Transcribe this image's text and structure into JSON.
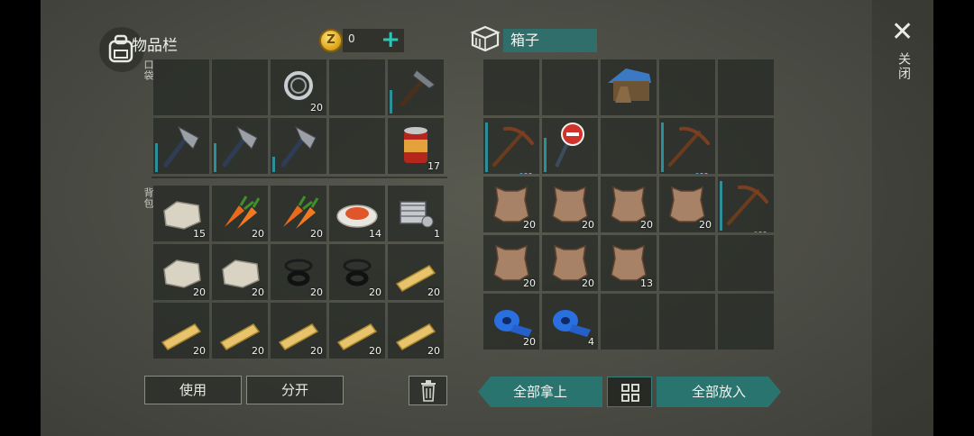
{
  "inventory": {
    "title": "物品栏",
    "coins": "0",
    "coin_symbol": "Z",
    "plus": "+",
    "pocket_label": "口袋",
    "backpack_label": "背包",
    "pocket_slots": [
      {
        "icon": "",
        "count": ""
      },
      {
        "icon": "",
        "count": ""
      },
      {
        "icon": "bearing-icon",
        "count": "20"
      },
      {
        "icon": "",
        "count": ""
      },
      {
        "icon": "hammer-icon",
        "count": "",
        "durability": 0.45
      },
      {
        "icon": "hatchet-icon",
        "count": "",
        "durability": 0.55
      },
      {
        "icon": "hatchet-icon",
        "count": "",
        "durability": 0.55
      },
      {
        "icon": "hatchet-icon",
        "count": "",
        "durability": 0.3
      },
      {
        "icon": "",
        "count": ""
      },
      {
        "icon": "canned-food-icon",
        "count": "17"
      }
    ],
    "backpack_slots": [
      {
        "icon": "stone-icon",
        "count": "15"
      },
      {
        "icon": "carrot-icon",
        "count": "20"
      },
      {
        "icon": "carrot-icon",
        "count": "20"
      },
      {
        "icon": "meal-plate-icon",
        "count": "14"
      },
      {
        "icon": "engine-icon",
        "count": "1"
      },
      {
        "icon": "stone-icon",
        "count": "20"
      },
      {
        "icon": "stone-icon",
        "count": "20"
      },
      {
        "icon": "rubber-ring-icon",
        "count": "20"
      },
      {
        "icon": "rubber-ring-icon",
        "count": "20"
      },
      {
        "icon": "plank-icon",
        "count": "20"
      },
      {
        "icon": "plank-icon",
        "count": "20"
      },
      {
        "icon": "plank-icon",
        "count": "20"
      },
      {
        "icon": "plank-icon",
        "count": "20"
      },
      {
        "icon": "plank-icon",
        "count": "20"
      },
      {
        "icon": "plank-icon",
        "count": "20"
      }
    ],
    "use_label": "使用",
    "split_label": "分开"
  },
  "container": {
    "title": "箱子",
    "slots": [
      {
        "icon": "",
        "count": ""
      },
      {
        "icon": "",
        "count": ""
      },
      {
        "icon": "dog-kennel-icon",
        "count": ""
      },
      {
        "icon": "",
        "count": ""
      },
      {
        "icon": "",
        "count": ""
      },
      {
        "icon": "pickaxe-icon",
        "count": "",
        "durability": 0.95,
        "dots": true
      },
      {
        "icon": "stop-sign-icon",
        "count": "",
        "durability": 0.65
      },
      {
        "icon": "",
        "count": ""
      },
      {
        "icon": "pickaxe-icon",
        "count": "",
        "durability": 0.95,
        "dots": true
      },
      {
        "icon": "",
        "count": ""
      },
      {
        "icon": "leather-icon",
        "count": "20"
      },
      {
        "icon": "leather-icon",
        "count": "20"
      },
      {
        "icon": "leather-icon",
        "count": "20"
      },
      {
        "icon": "leather-icon",
        "count": "20"
      },
      {
        "icon": "pickaxe-icon",
        "count": "",
        "durability": 0.95,
        "dots": true
      },
      {
        "icon": "leather-icon",
        "count": "20"
      },
      {
        "icon": "leather-icon",
        "count": "20"
      },
      {
        "icon": "leather-icon",
        "count": "13"
      },
      {
        "icon": "",
        "count": ""
      },
      {
        "icon": "",
        "count": ""
      },
      {
        "icon": "duct-tape-icon",
        "count": "20"
      },
      {
        "icon": "duct-tape-icon",
        "count": "4"
      },
      {
        "icon": "",
        "count": ""
      },
      {
        "icon": "",
        "count": ""
      },
      {
        "icon": "",
        "count": ""
      }
    ],
    "take_all_label": "全部拿上",
    "put_all_label": "全部放入"
  },
  "close_label": "关闭",
  "colors": {
    "accent": "#2a7470",
    "durability": "#2c8f97"
  }
}
